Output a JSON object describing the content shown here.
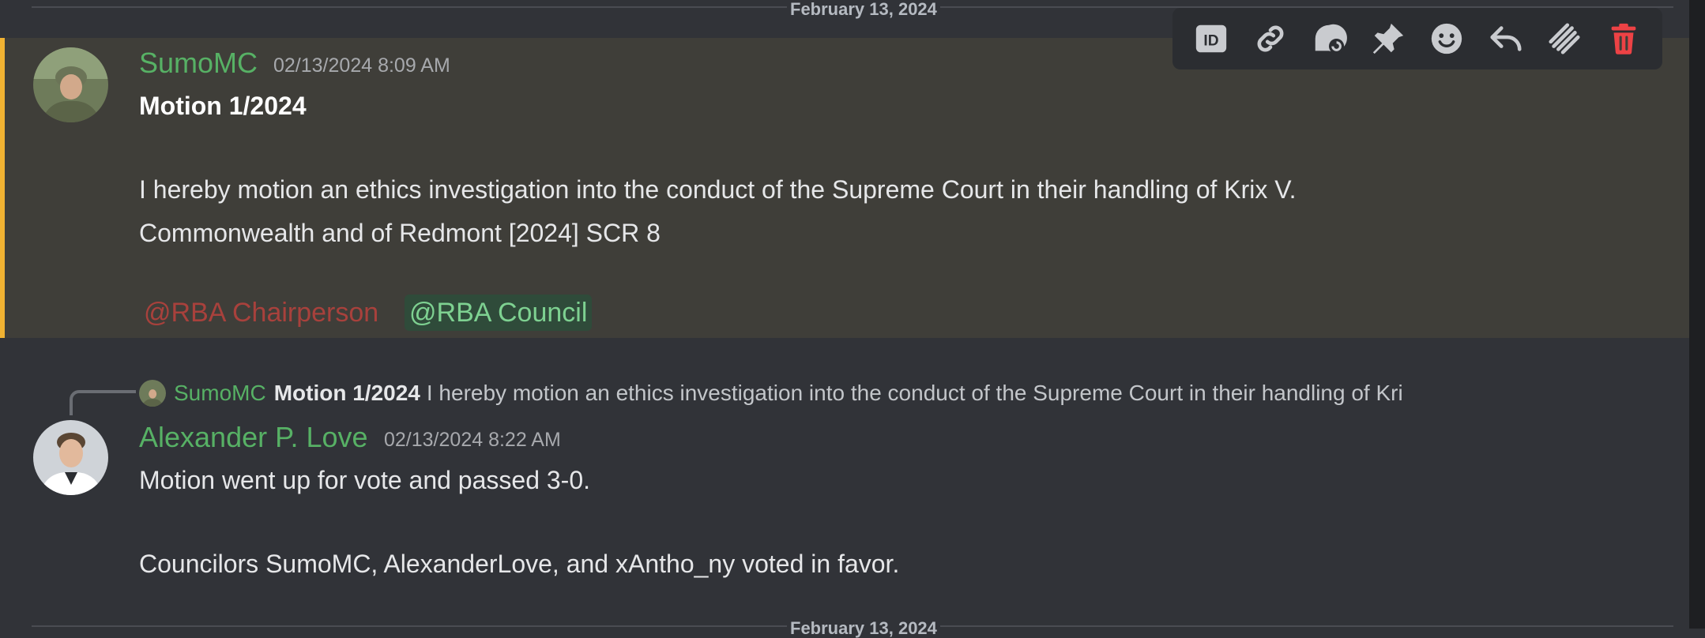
{
  "date_divider": {
    "top_label": "February 13, 2024",
    "bottom_label": "February 13, 2024"
  },
  "toolbar": {
    "buttons": [
      {
        "icon": "id-icon"
      },
      {
        "icon": "link-icon"
      },
      {
        "icon": "thread-icon"
      },
      {
        "icon": "pin-icon"
      },
      {
        "icon": "emoji-icon"
      },
      {
        "icon": "reply-icon"
      },
      {
        "icon": "message-log-icon"
      },
      {
        "icon": "delete-icon",
        "color": "#ed4245"
      }
    ]
  },
  "message1": {
    "author": "SumoMC",
    "timestamp": "02/13/2024 8:09 AM",
    "title": "Motion 1/2024",
    "line1": "I hereby motion an ethics investigation into the conduct of the Supreme Court in their handling of Krix V.",
    "line2": "Commonwealth and of Redmont [2024] SCR 8",
    "mention_red": "@RBA Chairperson",
    "mention_green": "@RBA Council",
    "highlight_color": "#f0b232"
  },
  "reply_preview": {
    "author": "SumoMC",
    "title": "Motion 1/2024",
    "text": "I hereby motion an ethics investigation into the conduct of the Supreme Court in their handling of Kri"
  },
  "message2": {
    "author": "Alexander P. Love",
    "timestamp": "02/13/2024 8:22 AM",
    "line1": "Motion went up for vote and passed 3-0.",
    "line2": "Councilors SumoMC, AlexanderLove, and xAntho_ny voted in favor."
  },
  "colors": {
    "background": "#313338",
    "username": "#57b165",
    "mention_green_bg": "#2f4b3a"
  }
}
